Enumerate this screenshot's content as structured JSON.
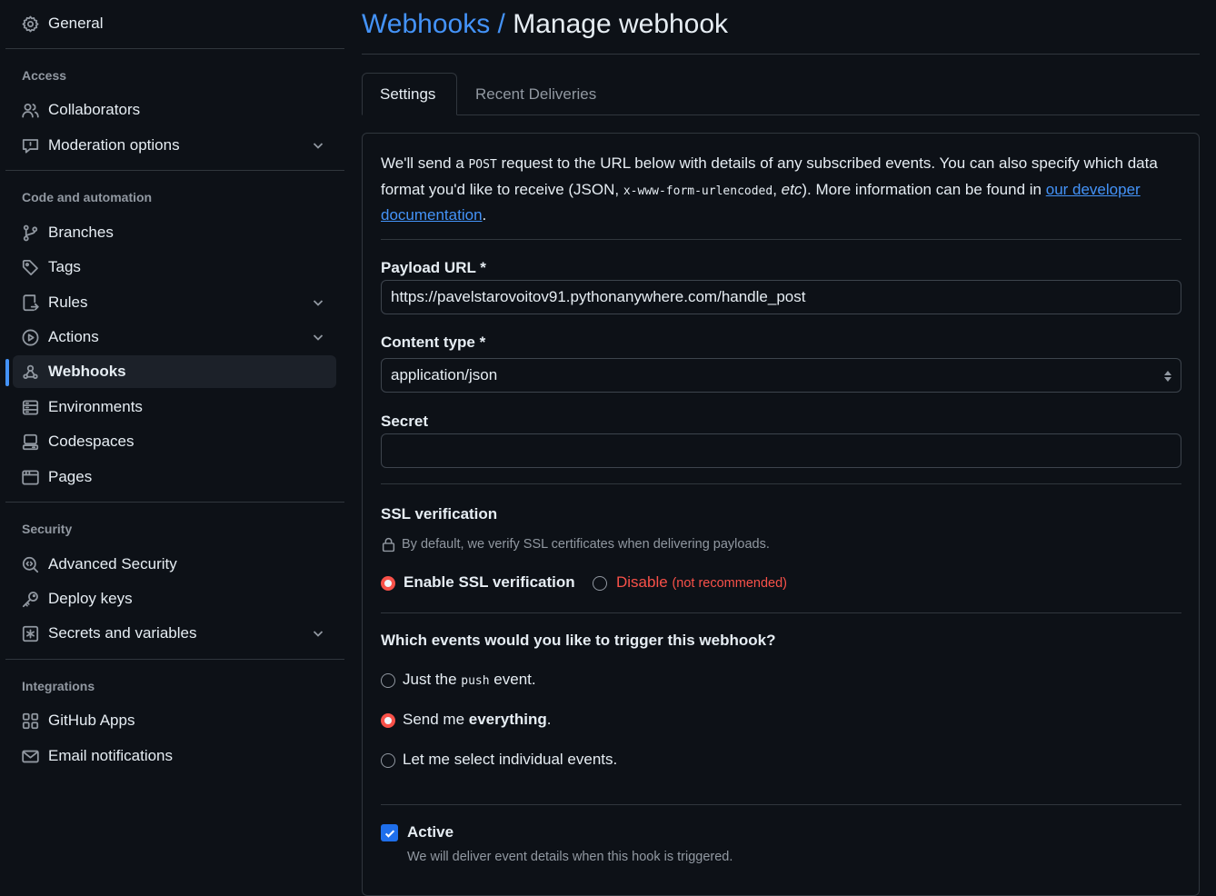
{
  "sidebar": {
    "general": "General",
    "groups": {
      "access": "Access",
      "code": "Code and automation",
      "security": "Security",
      "integrations": "Integrations"
    },
    "items": {
      "collaborators": "Collaborators",
      "moderation": "Moderation options",
      "branches": "Branches",
      "tags": "Tags",
      "rules": "Rules",
      "actions": "Actions",
      "webhooks": "Webhooks",
      "environments": "Environments",
      "codespaces": "Codespaces",
      "pages": "Pages",
      "advanced_security": "Advanced Security",
      "deploy_keys": "Deploy keys",
      "secrets": "Secrets and variables",
      "github_apps": "GitHub Apps",
      "email": "Email notifications"
    },
    "selected": "webhooks"
  },
  "header": {
    "breadcrumb": "Webhooks /",
    "title": "Manage webhook"
  },
  "tabs": {
    "settings": "Settings",
    "recent": "Recent Deliveries"
  },
  "form": {
    "intro": {
      "t1": "We'll send a ",
      "code1": "POST",
      "t2": " request to the URL below with details of any subscribed events. You can also specify which data format you'd like to receive (JSON, ",
      "code2": "x-www-form-urlencoded",
      "t3": ", ",
      "etc": "etc",
      "t4": "). More information can be found in ",
      "link": "our developer documentation",
      "t5": "."
    },
    "payload_label": "Payload URL *",
    "payload_value": "https://pavelstarovoitov91.pythonanywhere.com/handle_post",
    "content_label": "Content type *",
    "content_value": "application/json",
    "secret_label": "Secret",
    "secret_value": "",
    "ssl_label": "SSL verification",
    "ssl_note": "By default, we verify SSL certificates when delivering payloads.",
    "ssl_enable": "Enable SSL verification",
    "ssl_disable": "Disable",
    "ssl_disable_note": "(not recommended)",
    "events_label": "Which events would you like to trigger this webhook?",
    "ev_push_a": "Just the ",
    "ev_push_code": "push",
    "ev_push_b": " event.",
    "ev_all_a": "Send me ",
    "ev_all_b": "everything",
    "ev_all_c": ".",
    "ev_select": "Let me select individual events.",
    "active_label": "Active",
    "active_note": "We will deliver event details when this hook is triggered."
  }
}
